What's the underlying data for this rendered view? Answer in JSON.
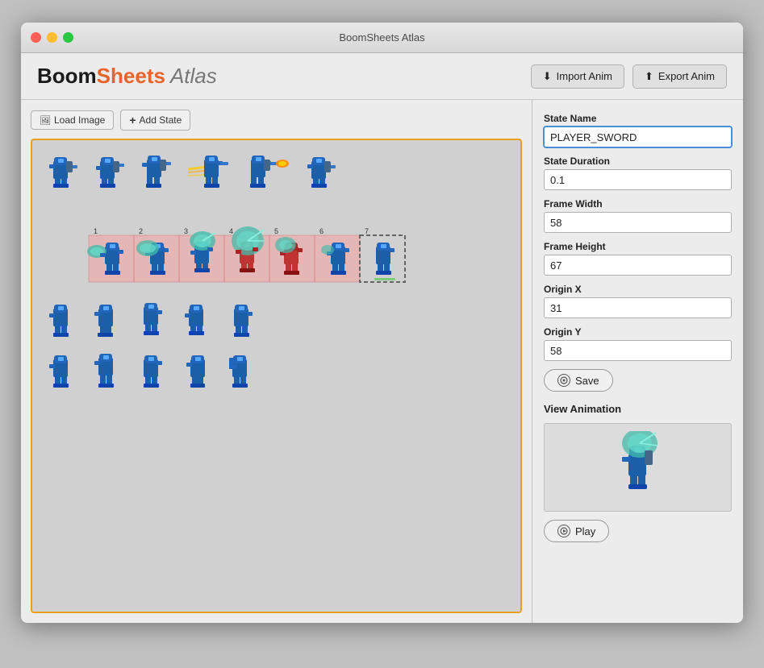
{
  "window": {
    "title": "BoomSheets Atlas"
  },
  "header": {
    "logo": {
      "boom": "Boom",
      "sheets": "Sheets",
      "atlas": "Atlas"
    },
    "import_btn": "Import Anim",
    "export_btn": "Export Anim"
  },
  "toolbar": {
    "load_image_label": "Load Image",
    "add_state_label": "Add State"
  },
  "right_panel": {
    "state_name_label": "State Name",
    "state_name_value": "PLAYER_SWORD",
    "state_duration_label": "State Duration",
    "state_duration_value": "0.1",
    "frame_width_label": "Frame Width",
    "frame_width_value": "58",
    "frame_height_label": "Frame Height",
    "frame_height_value": "67",
    "origin_x_label": "Origin X",
    "origin_x_value": "31",
    "origin_y_label": "Origin Y",
    "origin_y_value": "58",
    "save_label": "Save",
    "view_animation_label": "View Animation",
    "play_label": "Play"
  }
}
